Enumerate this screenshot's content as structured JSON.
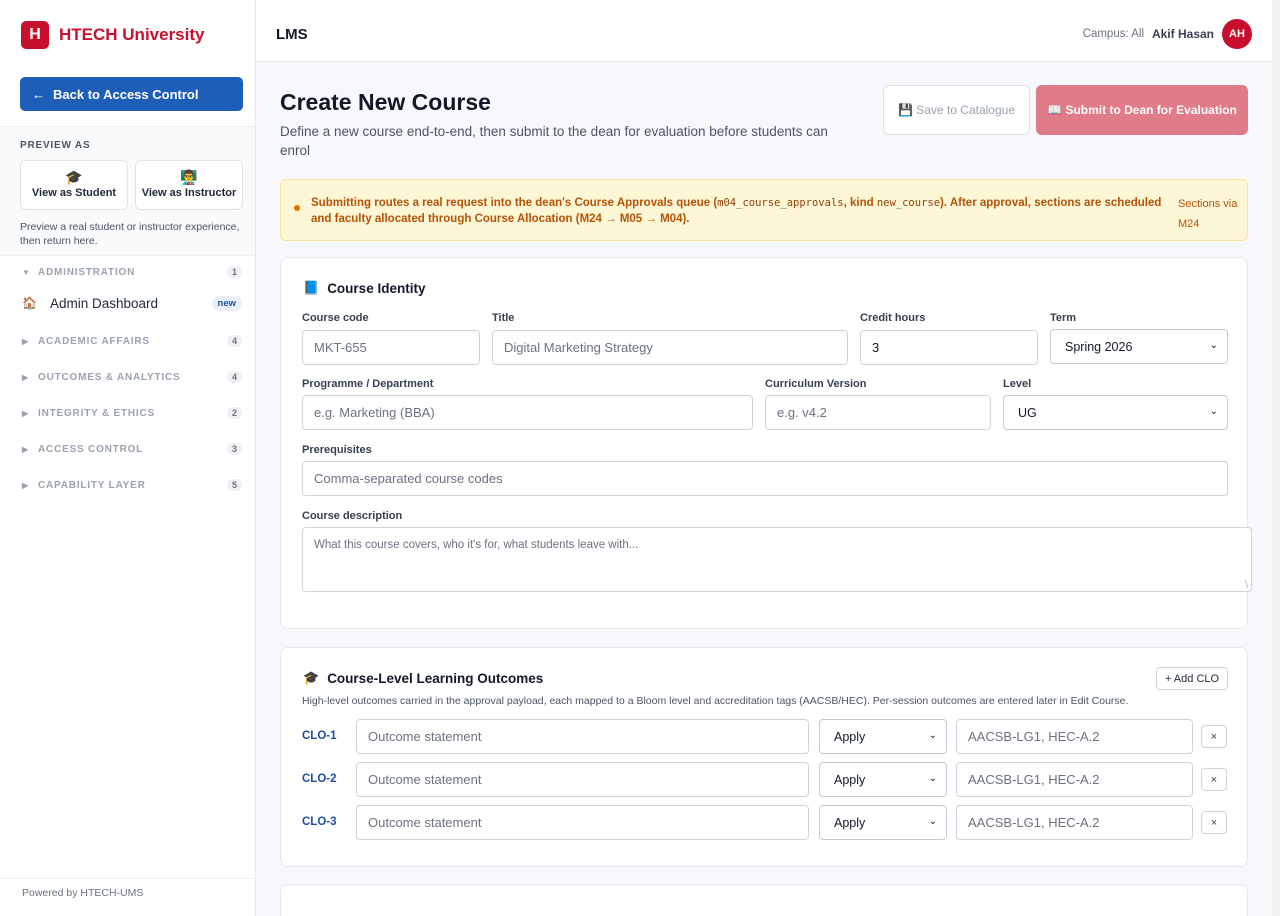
{
  "brand": {
    "logo_letter": "H",
    "name": "HTECH University"
  },
  "sidebar": {
    "back_label": "Back to Access Control",
    "back_arrow": "←",
    "preview_label": "PREVIEW AS",
    "preview_student": {
      "icon": "🎓",
      "label": "View as Student"
    },
    "preview_instructor": {
      "icon": "👨‍🏫",
      "label": "View as Instructor"
    },
    "preview_note": "Preview a real student or instructor experience, then return here.",
    "groups": [
      {
        "label": "ADMINISTRATION",
        "count": "1",
        "caret": "▼"
      },
      {
        "label": "ACADEMIC AFFAIRS",
        "count": "4",
        "caret": "▶"
      },
      {
        "label": "OUTCOMES & ANALYTICS",
        "count": "4",
        "caret": "▶"
      },
      {
        "label": "INTEGRITY & ETHICS",
        "count": "2",
        "caret": "▶"
      },
      {
        "label": "ACCESS CONTROL",
        "count": "3",
        "caret": "▶"
      },
      {
        "label": "CAPABILITY LAYER",
        "count": "5",
        "caret": "▶"
      }
    ],
    "admin_item": {
      "icon": "🏠",
      "label": "Admin Dashboard",
      "badge": "new"
    },
    "footer": "Powered by HTECH-UMS"
  },
  "topbar": {
    "app": "LMS",
    "campus": "Campus: All",
    "user": "Akif Hasan",
    "initials": "AH"
  },
  "header": {
    "title": "Create New Course",
    "subtitle": "Define a new course end-to-end, then submit to the dean for evaluation before students can enrol",
    "save_icon": "💾",
    "save_label": "Save to Catalogue",
    "submit_icon": "📖",
    "submit_label": "Submit to Dean for Evaluation"
  },
  "alert": {
    "part1": "Submitting routes a real request into the dean's Course Approvals queue (",
    "code1": "m04_course_approvals",
    "part2": ", kind ",
    "code2": "new_course",
    "part3": "). After approval, sections are scheduled and faculty allocated through Course Allocation (M24 → M05 → M04).",
    "side": "Sections via M24"
  },
  "identity": {
    "icon": "📘",
    "title": "Course Identity",
    "course_code": {
      "label": "Course code",
      "value": "MKT-655"
    },
    "title_field": {
      "label": "Title",
      "value": "Digital Marketing Strategy"
    },
    "credit_hours": {
      "label": "Credit hours",
      "value": "3"
    },
    "term": {
      "label": "Term",
      "value": "Spring 2026"
    },
    "programme": {
      "label": "Programme / Department",
      "placeholder": "e.g. Marketing (BBA)"
    },
    "curriculum": {
      "label": "Curriculum Version",
      "placeholder": "e.g. v4.2"
    },
    "level": {
      "label": "Level",
      "value": "UG"
    },
    "prereq": {
      "label": "Prerequisites",
      "placeholder": "Comma-separated course codes"
    },
    "description": {
      "label": "Course description",
      "placeholder": "What this course covers, who it's for, what students leave with..."
    }
  },
  "outcomes": {
    "icon": "🎓",
    "title": "Course-Level Learning Outcomes",
    "add_label": "+ Add CLO",
    "description": "High-level outcomes carried in the approval payload, each mapped to a Bloom level and accreditation tags (AACSB/HEC). Per-session outcomes are entered later in Edit Course.",
    "rows": [
      {
        "code": "CLO-1",
        "placeholder": "Outcome statement",
        "bloom": "Apply",
        "tags": "AACSB-LG1, HEC-A.2",
        "remove": "×"
      },
      {
        "code": "CLO-2",
        "placeholder": "Outcome statement",
        "bloom": "Apply",
        "tags": "AACSB-LG1, HEC-A.2",
        "remove": "×"
      },
      {
        "code": "CLO-3",
        "placeholder": "Outcome statement",
        "bloom": "Apply",
        "tags": "AACSB-LG1, HEC-A.2",
        "remove": "×"
      }
    ]
  },
  "colors": {
    "brand_red": "#c8102e",
    "primary_blue": "#1f5eb8",
    "submit_pink": "#e07b89",
    "alert_bg": "#fef7d6"
  }
}
